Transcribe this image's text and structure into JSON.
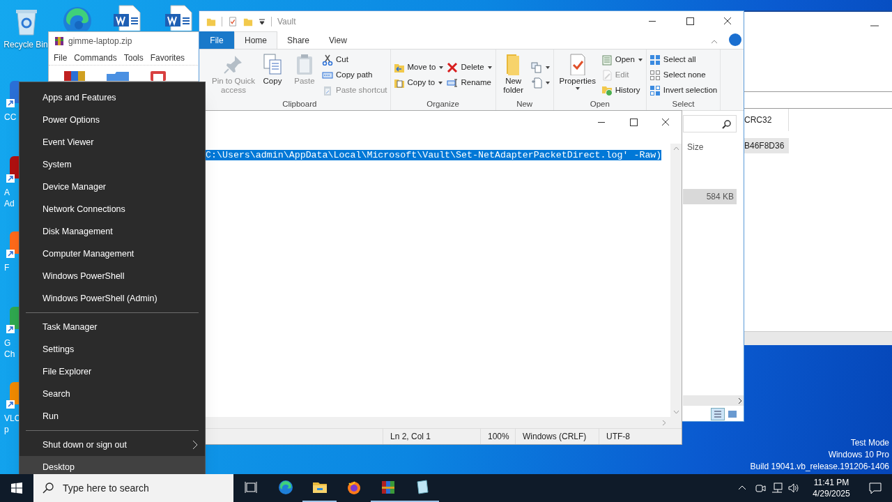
{
  "desktop": {
    "top_icons": [
      {
        "kind": "recycle",
        "label": "Recycle Bin"
      },
      {
        "kind": "edge"
      },
      {
        "kind": "word"
      },
      {
        "kind": "word"
      }
    ],
    "side_icons": [
      {
        "kind": "app",
        "color": "#2a6fd6",
        "label_lines": [
          "CC"
        ]
      },
      {
        "kind": "app",
        "color": "#b01010",
        "label_lines": [
          "A",
          "Ad"
        ]
      },
      {
        "kind": "app",
        "color": "#ff6a1a",
        "label_lines": [
          "F"
        ]
      },
      {
        "kind": "app",
        "color": "#2fa84f",
        "label_lines": [
          "G",
          "Ch"
        ]
      },
      {
        "kind": "app",
        "color": "#f08a00",
        "label_lines": [
          "VLC",
          "p"
        ]
      }
    ],
    "system_info": [
      "Test Mode",
      "Windows 10 Pro",
      "Build 19041.vb_release.191206-1406"
    ]
  },
  "archive_window": {
    "title": "gimme-laptop.zip",
    "menu": [
      "File",
      "Commands",
      "Tools",
      "Favorites"
    ]
  },
  "back_window": {
    "column": "CRC32",
    "cell": "B46F8D36"
  },
  "explorer": {
    "title": "Vault",
    "tabs": [
      {
        "label": "File",
        "selected": false,
        "kind": "file"
      },
      {
        "label": "Home",
        "selected": true,
        "kind": "tab"
      },
      {
        "label": "Share",
        "selected": false,
        "kind": "tab"
      },
      {
        "label": "View",
        "selected": false,
        "kind": "tab"
      }
    ],
    "groups": [
      {
        "label": "Clipboard",
        "columns": [
          {
            "kind": "large",
            "buttons": [
              {
                "kind": "pin",
                "label": "Pin to Quick access",
                "disabled": true
              }
            ]
          },
          {
            "kind": "large",
            "buttons": [
              {
                "kind": "copy",
                "label": "Copy",
                "disabled": false
              }
            ]
          },
          {
            "kind": "large",
            "buttons": [
              {
                "kind": "paste",
                "label": "Paste",
                "disabled": true
              }
            ]
          },
          {
            "kind": "small",
            "buttons": [
              {
                "kind": "cut",
                "label": "Cut",
                "disabled": false
              },
              {
                "kind": "copypath",
                "label": "Copy path",
                "disabled": false
              },
              {
                "kind": "pasteshortcut",
                "label": "Paste shortcut",
                "disabled": true
              }
            ]
          }
        ]
      },
      {
        "label": "Organize",
        "columns": [
          {
            "kind": "small",
            "buttons": [
              {
                "kind": "moveto",
                "label": "Move to",
                "dropdown": true,
                "disabled": false
              },
              {
                "kind": "copyto",
                "label": "Copy to",
                "dropdown": true,
                "disabled": false
              }
            ]
          },
          {
            "kind": "small",
            "buttons": [
              {
                "kind": "delete",
                "label": "Delete",
                "dropdown": true,
                "disabled": false
              },
              {
                "kind": "rename",
                "label": "Rename",
                "disabled": false
              }
            ]
          }
        ]
      },
      {
        "label": "New",
        "columns": [
          {
            "kind": "large",
            "buttons": [
              {
                "kind": "newfolder",
                "label": "New folder",
                "disabled": false
              }
            ]
          },
          {
            "kind": "small",
            "buttons": [
              {
                "kind": "newitem",
                "dropdown": true
              },
              {
                "kind": "easyaccess",
                "dropdown": true
              }
            ]
          }
        ]
      },
      {
        "label": "Open",
        "columns": [
          {
            "kind": "large",
            "buttons": [
              {
                "kind": "properties",
                "label": "Properties",
                "dropdown": true,
                "disabled": false
              }
            ]
          },
          {
            "kind": "small",
            "buttons": [
              {
                "kind": "open",
                "label": "Open",
                "dropdown": true,
                "disabled": false
              },
              {
                "kind": "edit",
                "label": "Edit",
                "disabled": true
              },
              {
                "kind": "history",
                "label": "History",
                "disabled": false
              }
            ]
          }
        ]
      },
      {
        "label": "Select",
        "columns": [
          {
            "kind": "small",
            "buttons": [
              {
                "kind": "selectall",
                "label": "Select all",
                "disabled": false
              },
              {
                "kind": "selectnone",
                "label": "Select none",
                "disabled": false
              },
              {
                "kind": "invert",
                "label": "Invert selection",
                "disabled": false
              }
            ]
          }
        ]
      }
    ],
    "column": "Size",
    "size_cell": "584 KB"
  },
  "notepad": {
    "text": "C:\\Users\\admin\\AppData\\Local\\Microsoft\\Vault\\Set-NetAdapterPacketDirect.log' -Raw)",
    "selected": true,
    "status": [
      "Ln 2, Col 1",
      "100%",
      "Windows (CRLF)",
      "UTF-8"
    ]
  },
  "context_menu": {
    "sections": [
      {
        "items": [
          {
            "label": "Apps and Features",
            "highlighted": false,
            "submenu": false
          },
          {
            "label": "Power Options",
            "highlighted": false,
            "submenu": false
          },
          {
            "label": "Event Viewer",
            "highlighted": false,
            "submenu": false
          },
          {
            "label": "System",
            "highlighted": false,
            "submenu": false
          },
          {
            "label": "Device Manager",
            "highlighted": false,
            "submenu": false
          },
          {
            "label": "Network Connections",
            "highlighted": false,
            "submenu": false
          },
          {
            "label": "Disk Management",
            "highlighted": false,
            "submenu": false
          },
          {
            "label": "Computer Management",
            "highlighted": false,
            "submenu": false
          },
          {
            "label": "Windows PowerShell",
            "highlighted": false,
            "submenu": false
          },
          {
            "label": "Windows PowerShell (Admin)",
            "highlighted": false,
            "submenu": false
          }
        ]
      },
      {
        "items": [
          {
            "label": "Task Manager",
            "highlighted": false,
            "submenu": false
          },
          {
            "label": "Settings",
            "highlighted": false,
            "submenu": false
          },
          {
            "label": "File Explorer",
            "highlighted": false,
            "submenu": false
          },
          {
            "label": "Search",
            "highlighted": false,
            "submenu": false
          },
          {
            "label": "Run",
            "highlighted": false,
            "submenu": false
          }
        ]
      },
      {
        "items": [
          {
            "label": "Shut down or sign out",
            "highlighted": false,
            "submenu": true
          },
          {
            "label": "Desktop",
            "highlighted": true,
            "submenu": false
          }
        ]
      }
    ]
  },
  "taskbar": {
    "search_placeholder": "Type here to search",
    "apps": [
      {
        "kind": "taskview",
        "running": false
      },
      {
        "kind": "edge",
        "running": false
      },
      {
        "kind": "explorer",
        "running": true
      },
      {
        "kind": "firefox",
        "running": false
      },
      {
        "kind": "winrar",
        "running": true
      },
      {
        "kind": "notepad",
        "running": true
      }
    ],
    "time": "11:41 PM",
    "date": "4/29/2025"
  }
}
